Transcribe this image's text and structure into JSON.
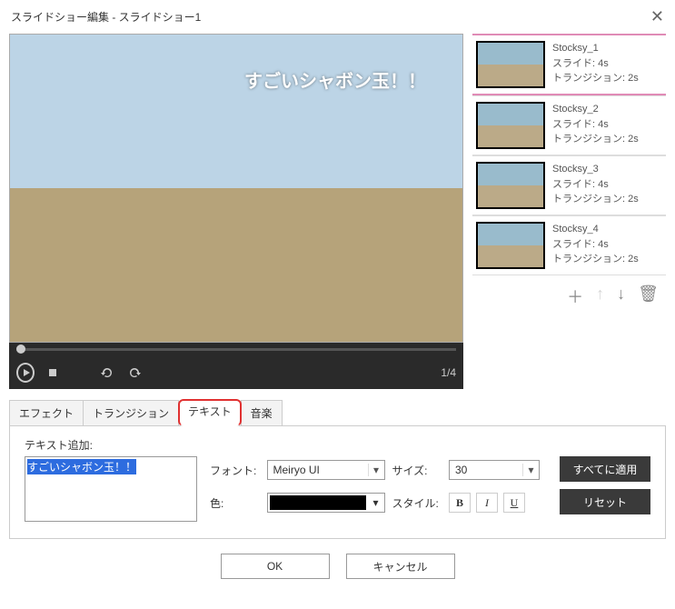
{
  "window": {
    "title": "スライドショー編集  -  スライドショー1"
  },
  "preview": {
    "overlay_text": "すごいシャボン玉！！",
    "counter": "1/4"
  },
  "thumbs": [
    {
      "name": "Stocksy_1",
      "slide": "スライド: 4s",
      "trans": "トランジション: 2s"
    },
    {
      "name": "Stocksy_2",
      "slide": "スライド: 4s",
      "trans": "トランジション: 2s"
    },
    {
      "name": "Stocksy_3",
      "slide": "スライド: 4s",
      "trans": "トランジション: 2s"
    },
    {
      "name": "Stocksy_4",
      "slide": "スライド: 4s",
      "trans": "トランジション: 2s"
    }
  ],
  "tabs": {
    "effect": "エフェクト",
    "transition": "トランジション",
    "text": "テキスト",
    "music": "音楽"
  },
  "text_panel": {
    "add_label": "テキスト追加:",
    "input_text": "すごいシャボン玉！！",
    "font_label": "フォント:",
    "font_value": "Meiryo UI",
    "size_label": "サイズ:",
    "size_value": "30",
    "color_label": "色:",
    "color_value": "#000000",
    "style_label": "スタイル:",
    "bold": "B",
    "italic": "I",
    "underline": "U",
    "apply_all": "すべてに適用",
    "reset": "リセット"
  },
  "buttons": {
    "ok": "OK",
    "cancel": "キャンセル"
  }
}
